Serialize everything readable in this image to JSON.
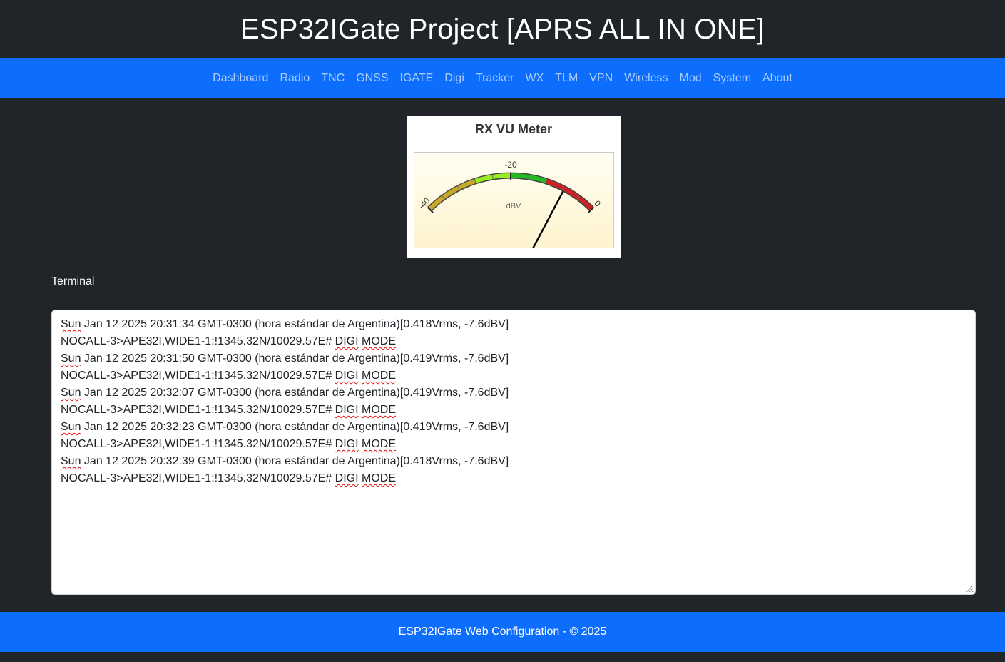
{
  "header": {
    "title": "ESP32IGate Project [APRS ALL IN ONE]"
  },
  "nav": {
    "items": [
      {
        "label": "Dashboard"
      },
      {
        "label": "Radio"
      },
      {
        "label": "TNC"
      },
      {
        "label": "GNSS"
      },
      {
        "label": "IGATE"
      },
      {
        "label": "Digi"
      },
      {
        "label": "Tracker"
      },
      {
        "label": "WX"
      },
      {
        "label": "TLM"
      },
      {
        "label": "VPN"
      },
      {
        "label": "Wireless"
      },
      {
        "label": "Mod"
      },
      {
        "label": "System"
      },
      {
        "label": "About"
      }
    ]
  },
  "vu_meter": {
    "title": "RX VU Meter",
    "unit": "dBV",
    "scale_min_label": "-40",
    "scale_mid_label": "-20",
    "scale_max_label": "0",
    "min": -40,
    "max": 0,
    "value": -7.6
  },
  "terminal": {
    "label": "Terminal",
    "lines": [
      {
        "first": "Sun",
        "rest": " Jan 12 2025 20:31:34 GMT-0300 (hora estándar de Argentina)[0.418Vrms, -7.6dBV]"
      },
      {
        "pre": "NOCALL-3>APE32I,WIDE1-1:!1345.32N/10029.57E# ",
        "w1": "DIGI",
        "w2": "MODE"
      },
      {
        "first": "Sun",
        "rest": " Jan 12 2025 20:31:50 GMT-0300 (hora estándar de Argentina)[0.419Vrms, -7.6dBV]"
      },
      {
        "pre": "NOCALL-3>APE32I,WIDE1-1:!1345.32N/10029.57E# ",
        "w1": "DIGI",
        "w2": "MODE"
      },
      {
        "first": "Sun",
        "rest": " Jan 12 2025 20:32:07 GMT-0300 (hora estándar de Argentina)[0.419Vrms, -7.6dBV]"
      },
      {
        "pre": "NOCALL-3>APE32I,WIDE1-1:!1345.32N/10029.57E# ",
        "w1": "DIGI",
        "w2": "MODE"
      },
      {
        "first": "Sun",
        "rest": " Jan 12 2025 20:32:23 GMT-0300 (hora estándar de Argentina)[0.419Vrms, -7.6dBV]"
      },
      {
        "pre": "NOCALL-3>APE32I,WIDE1-1:!1345.32N/10029.57E# ",
        "w1": "DIGI",
        "w2": "MODE"
      },
      {
        "first": "Sun",
        "rest": " Jan 12 2025 20:32:39 GMT-0300 (hora estándar de Argentina)[0.418Vrms, -7.6dBV]"
      },
      {
        "pre": "NOCALL-3>APE32I,WIDE1-1:!1345.32N/10029.57E# ",
        "w1": "DIGI",
        "w2": "MODE"
      }
    ]
  },
  "footer": {
    "text": "ESP32IGate Web Configuration - © 2025"
  },
  "colors": {
    "header_bg": "#212529",
    "primary": "#0d6efd",
    "gauge_olive": "#c8a82a",
    "gauge_lime": "#99ee22",
    "gauge_green": "#22bb22",
    "gauge_red": "#cc2222"
  }
}
